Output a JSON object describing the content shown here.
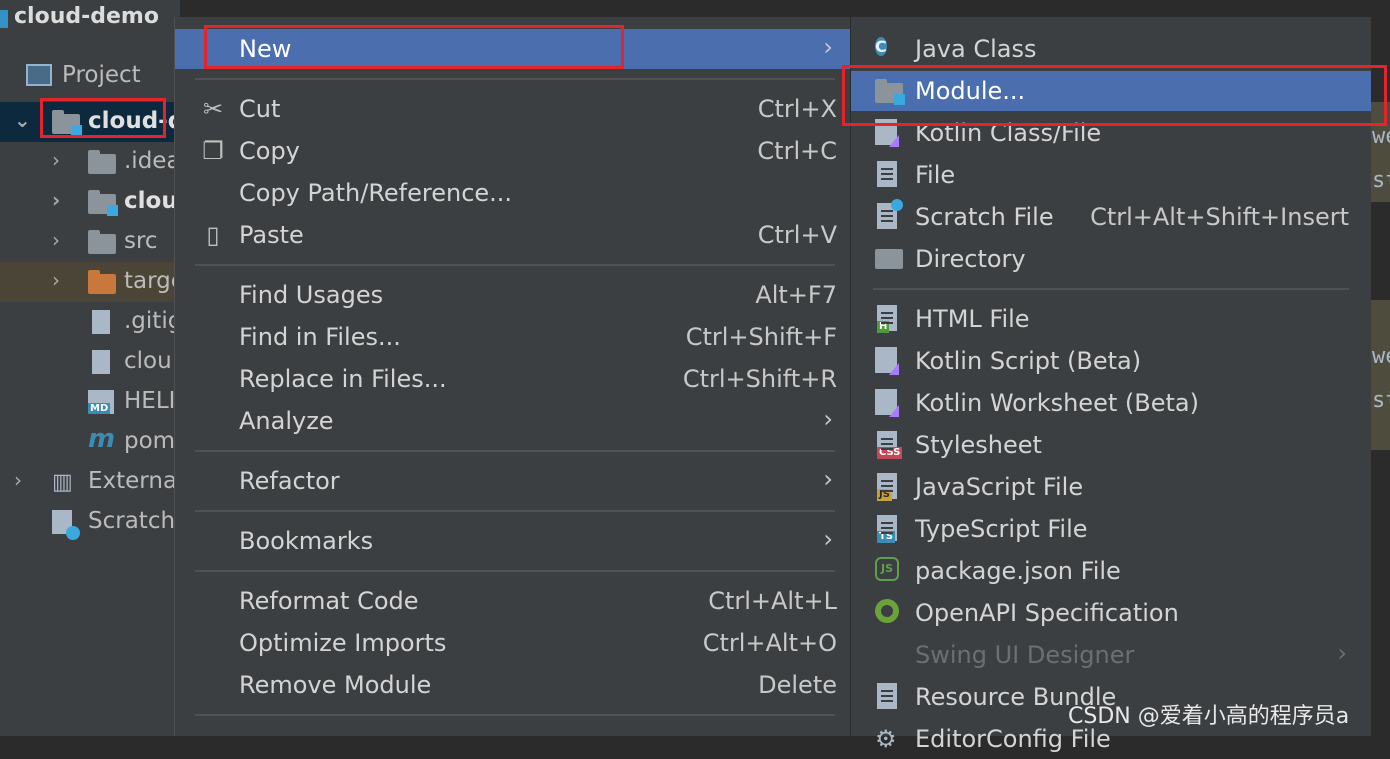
{
  "window": {
    "project_name": "cloud-demo"
  },
  "project_panel": {
    "tab_label": "Project",
    "tree": [
      {
        "label": "cloud-d",
        "icon": "module-folder-icon"
      },
      {
        "label": ".idea",
        "icon": "folder-icon"
      },
      {
        "label": "cloud",
        "icon": "module-folder-icon"
      },
      {
        "label": "src",
        "icon": "folder-icon"
      },
      {
        "label": "targe",
        "icon": "folder-orange-icon"
      },
      {
        "label": ".gitig",
        "icon": "gitignore-file-icon"
      },
      {
        "label": "clou",
        "icon": "file-icon"
      },
      {
        "label": "HELI",
        "icon": "markdown-file-icon"
      },
      {
        "label": "pom",
        "icon": "maven-icon"
      },
      {
        "label": "Externa",
        "icon": "libraries-icon"
      },
      {
        "label": "Scratch",
        "icon": "scratches-icon"
      }
    ]
  },
  "editor_strip": {
    "chars": [
      "we",
      "st",
      "we",
      "st"
    ]
  },
  "context_menu": {
    "items": [
      {
        "label": "New",
        "shortcut": "",
        "submenu": true,
        "icon": ""
      },
      {
        "label": "Cut",
        "shortcut": "Ctrl+X",
        "icon": "scissors-icon"
      },
      {
        "label": "Copy",
        "shortcut": "Ctrl+C",
        "icon": "copy-icon"
      },
      {
        "label": "Copy Path/Reference...",
        "shortcut": ""
      },
      {
        "label": "Paste",
        "shortcut": "Ctrl+V",
        "icon": "clipboard-icon"
      },
      {
        "label": "Find Usages",
        "shortcut": "Alt+F7"
      },
      {
        "label": "Find in Files...",
        "shortcut": "Ctrl+Shift+F"
      },
      {
        "label": "Replace in Files...",
        "shortcut": "Ctrl+Shift+R"
      },
      {
        "label": "Analyze",
        "shortcut": "",
        "submenu": true
      },
      {
        "label": "Refactor",
        "shortcut": "",
        "submenu": true
      },
      {
        "label": "Bookmarks",
        "shortcut": "",
        "submenu": true
      },
      {
        "label": "Reformat Code",
        "shortcut": "Ctrl+Alt+L"
      },
      {
        "label": "Optimize Imports",
        "shortcut": "Ctrl+Alt+O"
      },
      {
        "label": "Remove Module",
        "shortcut": "Delete"
      }
    ],
    "submenu_arrow": "›"
  },
  "new_submenu": {
    "items": [
      {
        "label": "Java Class",
        "icon": "java-class-icon",
        "icon_text": "C"
      },
      {
        "label": "Module...",
        "icon": "module-icon"
      },
      {
        "label": "Kotlin Class/File",
        "icon": "kotlin-icon"
      },
      {
        "label": "File",
        "icon": "file-icon"
      },
      {
        "label": "Scratch File",
        "shortcut": "Ctrl+Alt+Shift+Insert",
        "icon": "scratch-file-icon"
      },
      {
        "label": "Directory",
        "icon": "directory-icon"
      },
      {
        "label": "HTML File",
        "icon": "html-file-icon",
        "badge": "H"
      },
      {
        "label": "Kotlin Script (Beta)",
        "icon": "kotlin-script-icon"
      },
      {
        "label": "Kotlin Worksheet (Beta)",
        "icon": "kotlin-worksheet-icon"
      },
      {
        "label": "Stylesheet",
        "icon": "css-file-icon",
        "badge": "CSS"
      },
      {
        "label": "JavaScript File",
        "icon": "javascript-file-icon",
        "badge": "JS"
      },
      {
        "label": "TypeScript File",
        "icon": "typescript-file-icon",
        "badge": "TS"
      },
      {
        "label": "package.json File",
        "icon": "nodejs-icon",
        "icon_text": "JS"
      },
      {
        "label": "OpenAPI Specification",
        "icon": "openapi-icon"
      },
      {
        "label": "Swing UI Designer",
        "icon": "",
        "disabled": true,
        "submenu": true
      },
      {
        "label": "Resource Bundle",
        "icon": "resource-bundle-icon"
      },
      {
        "label": "EditorConfig File",
        "icon": "gear-icon"
      }
    ]
  },
  "watermark": {
    "text": "CSDN @爱着小高的程序员a"
  },
  "colors": {
    "highlight": "#4b6eaf",
    "menu_bg": "#3c3f41",
    "red_box": "#e5232b"
  }
}
